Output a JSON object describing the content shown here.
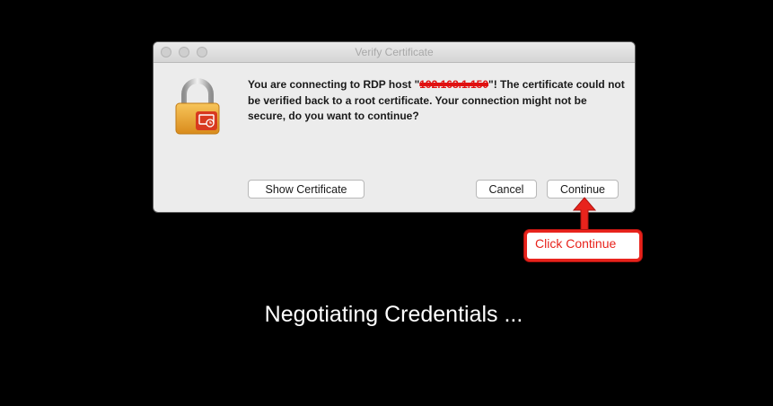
{
  "dialog": {
    "title": "Verify Certificate",
    "message_prefix": "You are connecting to RDP host \"",
    "host_redacted": "192.168.1.150",
    "message_suffix": "\"! The certificate could not be verified back to a root certificate. Your connection might not be secure, do you want to continue?",
    "buttons": {
      "show_certificate": "Show Certificate",
      "cancel": "Cancel",
      "continue": "Continue"
    }
  },
  "annotation": {
    "callout_text": "Click Continue",
    "color": "#e8231c"
  },
  "status_text": "Negotiating Credentials ...",
  "icons": {
    "lock": "lock-icon",
    "window_controls": [
      "close-icon",
      "minimize-icon",
      "zoom-icon"
    ]
  }
}
